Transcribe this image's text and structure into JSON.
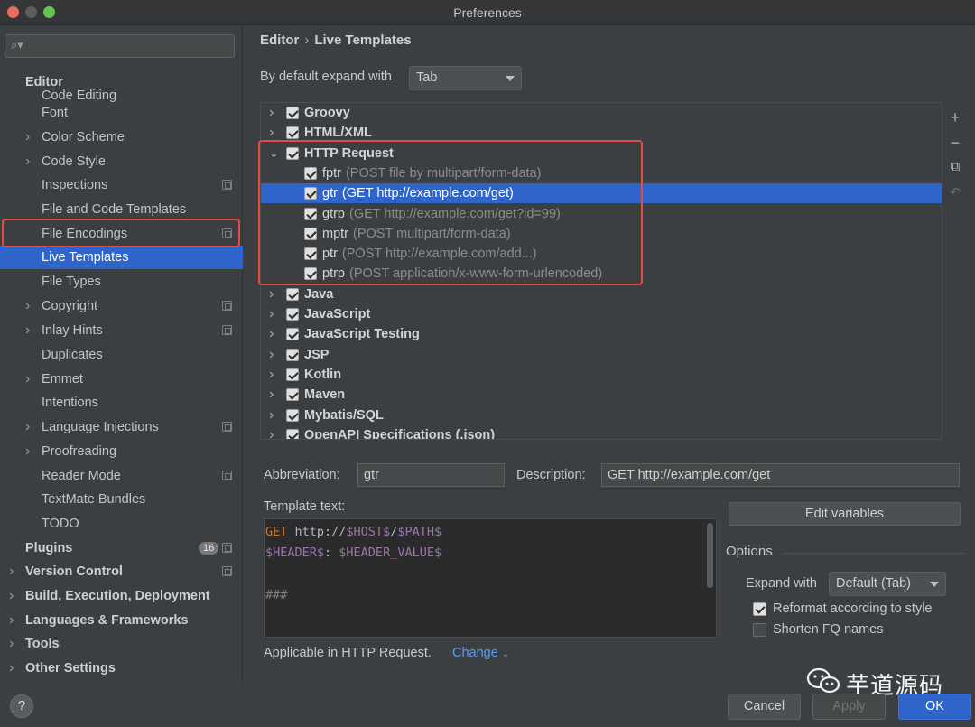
{
  "window": {
    "title": "Preferences"
  },
  "search": {
    "placeholder": "",
    "icon": "search-icon"
  },
  "sidebar": {
    "items": [
      {
        "label": "Editor",
        "level": 0,
        "expandable": false
      },
      {
        "label": "Code Editing",
        "level": 1
      },
      {
        "label": "Font",
        "level": 1
      },
      {
        "label": "Color Scheme",
        "level": 1,
        "expandable": true
      },
      {
        "label": "Code Style",
        "level": 1,
        "expandable": true
      },
      {
        "label": "Inspections",
        "level": 1,
        "copy_icon": true
      },
      {
        "label": "File and Code Templates",
        "level": 1
      },
      {
        "label": "File Encodings",
        "level": 1,
        "copy_icon": true
      },
      {
        "label": "Live Templates",
        "level": 1,
        "selected": true
      },
      {
        "label": "File Types",
        "level": 1
      },
      {
        "label": "Copyright",
        "level": 1,
        "expandable": true,
        "copy_icon": true
      },
      {
        "label": "Inlay Hints",
        "level": 1,
        "expandable": true,
        "copy_icon": true
      },
      {
        "label": "Duplicates",
        "level": 1
      },
      {
        "label": "Emmet",
        "level": 1,
        "expandable": true
      },
      {
        "label": "Intentions",
        "level": 1
      },
      {
        "label": "Language Injections",
        "level": 1,
        "expandable": true,
        "copy_icon": true
      },
      {
        "label": "Proofreading",
        "level": 1,
        "expandable": true
      },
      {
        "label": "Reader Mode",
        "level": 1,
        "copy_icon": true
      },
      {
        "label": "TextMate Bundles",
        "level": 1
      },
      {
        "label": "TODO",
        "level": 1
      },
      {
        "label": "Plugins",
        "level": 0,
        "badge": "16",
        "copy_icon": true
      },
      {
        "label": "Version Control",
        "level": 0,
        "expandable": true,
        "copy_icon": true
      },
      {
        "label": "Build, Execution, Deployment",
        "level": 0,
        "expandable": true
      },
      {
        "label": "Languages & Frameworks",
        "level": 0,
        "expandable": true
      },
      {
        "label": "Tools",
        "level": 0,
        "expandable": true
      },
      {
        "label": "Other Settings",
        "level": 0,
        "expandable": true
      }
    ]
  },
  "breadcrumb": {
    "parent": "Editor",
    "separator": "›",
    "current": "Live Templates"
  },
  "expand": {
    "label": "By default expand with",
    "value": "Tab"
  },
  "templates": {
    "groups_before": [
      {
        "name": "Groovy",
        "checked": true
      },
      {
        "name": "HTML/XML",
        "checked": true
      }
    ],
    "open_group": {
      "name": "HTTP Request",
      "checked": true,
      "items": [
        {
          "abbr": "fptr",
          "desc": "(POST file by multipart/form-data)"
        },
        {
          "abbr": "gtr",
          "desc": "(GET http://example.com/get)",
          "selected": true
        },
        {
          "abbr": "gtrp",
          "desc": "(GET http://example.com/get?id=99)"
        },
        {
          "abbr": "mptr",
          "desc": "(POST multipart/form-data)"
        },
        {
          "abbr": "ptr",
          "desc": "(POST http://example.com/add...)"
        },
        {
          "abbr": "ptrp",
          "desc": "(POST application/x-www-form-urlencoded)"
        }
      ]
    },
    "groups_after": [
      {
        "name": "Java",
        "checked": true
      },
      {
        "name": "JavaScript",
        "checked": true
      },
      {
        "name": "JavaScript Testing",
        "checked": true
      },
      {
        "name": "JSP",
        "checked": true
      },
      {
        "name": "Kotlin",
        "checked": true
      },
      {
        "name": "Maven",
        "checked": true
      },
      {
        "name": "Mybatis/SQL",
        "checked": true
      },
      {
        "name": "OpenAPI Specifications (.json)",
        "checked": true
      }
    ]
  },
  "toolbar_icons": [
    "plus-icon",
    "minus-icon",
    "duplicate-icon",
    "revert-icon"
  ],
  "editor": {
    "abbreviation_label": "Abbreviation:",
    "abbreviation_value": "gtr",
    "description_label": "Description:",
    "description_value": "GET http://example.com/get",
    "template_text_label": "Template text:",
    "template_lines": [
      [
        {
          "t": "GET",
          "c": "kw"
        },
        {
          "t": " http://",
          "c": "plain"
        },
        {
          "t": "$HOST$",
          "c": "var"
        },
        {
          "t": "/",
          "c": "plain"
        },
        {
          "t": "$PATH$",
          "c": "var"
        }
      ],
      [
        {
          "t": "$HEADER$",
          "c": "var"
        },
        {
          "t": ": ",
          "c": "plain"
        },
        {
          "t": "$HEADER_VALUE$",
          "c": "var"
        }
      ],
      [],
      [
        {
          "t": "###",
          "c": "comment"
        }
      ]
    ],
    "edit_variables_label": "Edit variables",
    "options_title": "Options",
    "expand_with_label": "Expand with",
    "expand_with_value": "Default (Tab)",
    "reformat_label": "Reformat according to style",
    "reformat_checked": true,
    "shorten_label": "Shorten FQ names",
    "shorten_checked": false,
    "applicable_text": "Applicable in HTTP Request.",
    "change_label": "Change"
  },
  "footer": {
    "help_label": "?",
    "watermark_text": "芋道源码",
    "cancel_label": "Cancel",
    "apply_label": "Apply",
    "ok_label": "OK"
  },
  "colors": {
    "selection": "#2f65ca",
    "highlight_outline": "#e24d42",
    "link": "#589df6"
  }
}
